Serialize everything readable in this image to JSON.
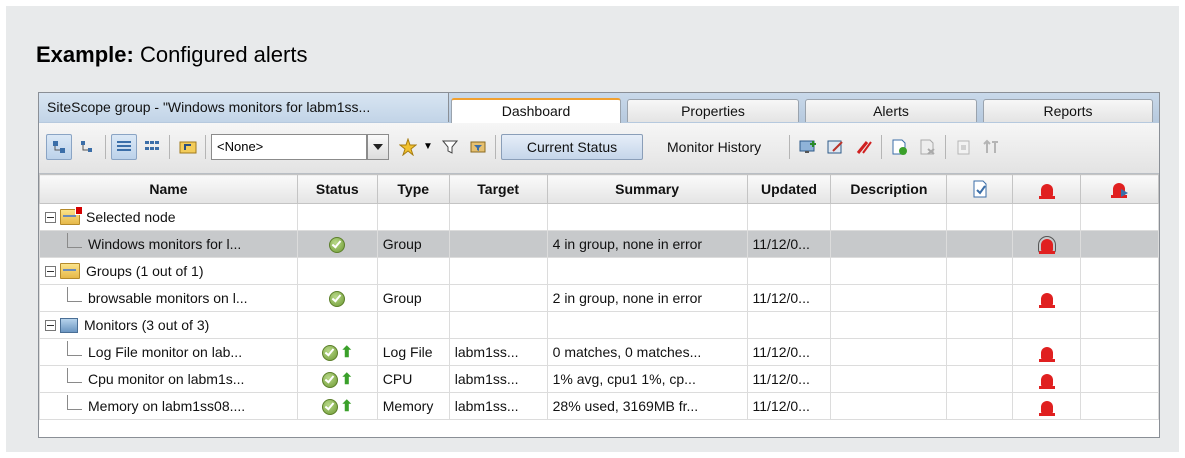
{
  "caption": {
    "bold": "Example:",
    "text": " Configured alerts"
  },
  "group_title": "SiteScope group - \"Windows monitors for labm1ss...",
  "tabs": [
    "Dashboard",
    "Properties",
    "Alerts",
    "Reports"
  ],
  "active_tab": "Dashboard",
  "toolbar": {
    "filter_value": "<None>",
    "current_status_label": "Current Status",
    "monitor_history_label": "Monitor History"
  },
  "columns": [
    "Name",
    "Status",
    "Type",
    "Target",
    "Summary",
    "Updated",
    "Description"
  ],
  "rows": [
    {
      "name": "Selected node",
      "kind": "node",
      "status": "",
      "type": "",
      "target": "",
      "summary": "",
      "updated": "",
      "description": ""
    },
    {
      "name": "Windows monitors for l...",
      "kind": "child",
      "status": "ok",
      "type": "Group",
      "target": "",
      "summary": "4 in group, none in error",
      "updated": "11/12/0...",
      "description": "",
      "selected": true
    },
    {
      "name": "Groups (1 out of 1)",
      "kind": "group",
      "status": "",
      "type": "",
      "target": "",
      "summary": "",
      "updated": "",
      "description": ""
    },
    {
      "name": "browsable monitors on l...",
      "kind": "child",
      "status": "ok",
      "type": "Group",
      "target": "",
      "summary": "2 in group, none in error",
      "updated": "11/12/0...",
      "description": ""
    },
    {
      "name": "Monitors (3 out of 3)",
      "kind": "monitors",
      "status": "",
      "type": "",
      "target": "",
      "summary": "",
      "updated": "",
      "description": ""
    },
    {
      "name": "Log File monitor on lab...",
      "kind": "child",
      "status": "ok-trend",
      "type": "Log File",
      "target": "labm1ss...",
      "summary": "0 matches, 0 matches...",
      "updated": "11/12/0...",
      "description": ""
    },
    {
      "name": "Cpu monitor on labm1s...",
      "kind": "child",
      "status": "ok-trend",
      "type": "CPU",
      "target": "labm1ss...",
      "summary": "1% avg, cpu1 1%, cp...",
      "updated": "11/12/0...",
      "description": ""
    },
    {
      "name": "Memory on labm1ss08....",
      "kind": "child",
      "status": "ok-trend",
      "type": "Memory",
      "target": "labm1ss...",
      "summary": "28% used, 3169MB fr...",
      "updated": "11/12/0...",
      "description": ""
    }
  ],
  "colors": {
    "selected_row": "#c7c9cb",
    "alert_red": "#e02020",
    "ok_green": "#6e9a33",
    "tab_accent": "#f0a030"
  }
}
